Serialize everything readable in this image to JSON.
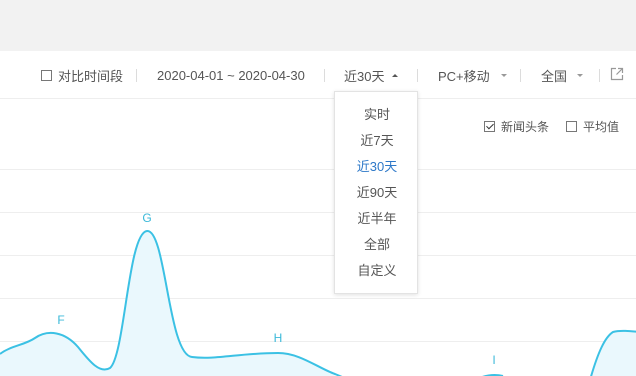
{
  "toolbar": {
    "compare_label": "对比时间段",
    "date_range": "2020-04-01 ~ 2020-04-30",
    "period_label": "近30天",
    "device_label": "PC+移动",
    "region_label": "全国"
  },
  "period_menu": {
    "options": [
      "实时",
      "近7天",
      "近30天",
      "近90天",
      "近半年",
      "全部",
      "自定义"
    ],
    "selected": "近30天"
  },
  "legend": {
    "series_label": "新闻头条",
    "series_checked": true,
    "average_label": "平均值",
    "average_checked": false
  },
  "chart_data": {
    "type": "area",
    "color": "#3bc1e4",
    "fill": "#eaf8fd",
    "point_labels": [
      "F",
      "G",
      "H",
      "I"
    ]
  },
  "colors": {
    "accent": "#2d78c8",
    "series": "#3bc1e4",
    "label": "#3bb9d9"
  }
}
